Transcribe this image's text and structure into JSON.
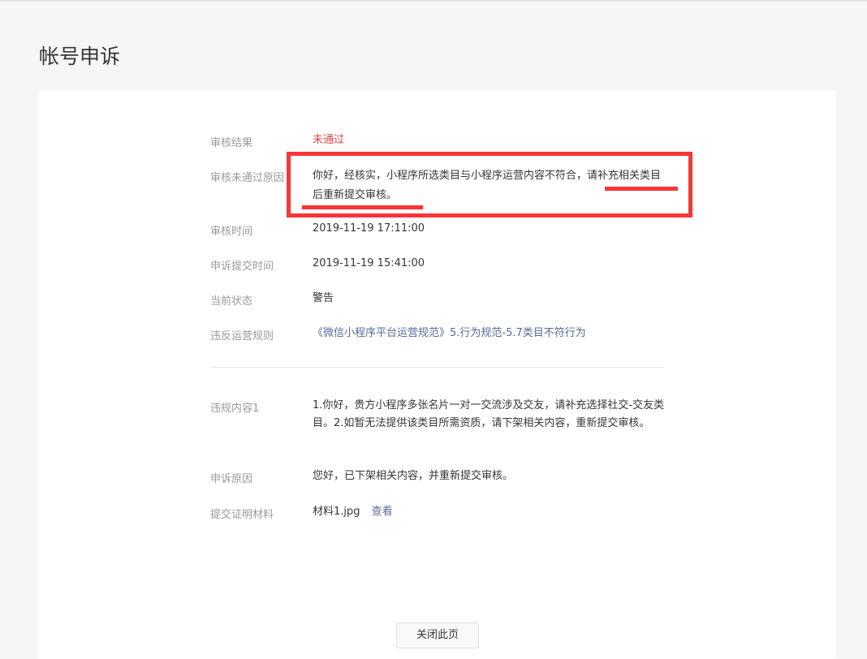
{
  "page_title": "帐号申诉",
  "details": {
    "result": {
      "label": "审核结果",
      "value": "未通过"
    },
    "reason": {
      "label": "审核未通过原因",
      "value": "你好，经核实，小程序所选类目与小程序运营内容不符合，请补充相关类目后重新提交审核。"
    },
    "review_time": {
      "label": "审核时间",
      "value": "2019-11-19 17:11:00"
    },
    "submit_time": {
      "label": "申诉提交时间",
      "value": "2019-11-19 15:41:00"
    },
    "status": {
      "label": "当前状态",
      "value": "警告"
    },
    "rule": {
      "label": "违反运营规则",
      "value": "《微信小程序平台运营规范》5.行为规范-5.7类目不符行为"
    },
    "violation": {
      "label": "违规内容1",
      "value": "1.你好，贵方小程序多张名片一对一交流涉及交友，请补充选择社交-交友类目。2.如暂无法提供该类目所需资质，请下架相关内容，重新提交审核。"
    },
    "appeal_reason": {
      "label": "申诉原因",
      "value": "您好，已下架相关内容，并重新提交审核。"
    },
    "materials": {
      "label": "提交证明材料",
      "file": "材料1.jpg",
      "view_link": "查看"
    }
  },
  "close_button": "关闭此页",
  "colors": {
    "error": "#e64340",
    "link": "#576b95",
    "annotation": "#fa3437"
  }
}
